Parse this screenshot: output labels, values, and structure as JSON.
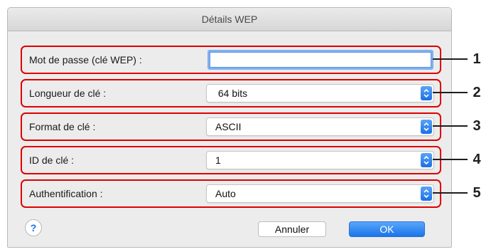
{
  "dialog": {
    "title": "Détails WEP"
  },
  "fields": {
    "password_label": "Mot de passe (clé WEP) :",
    "password_value": "",
    "key_length_label": "Longueur de clé :",
    "key_length_value": " 64 bits",
    "key_format_label": "Format de clé :",
    "key_format_value": "ASCII",
    "key_id_label": "ID de clé :",
    "key_id_value": "1",
    "auth_label": "Authentification :",
    "auth_value": "Auto"
  },
  "callouts": [
    "1",
    "2",
    "3",
    "4",
    "5"
  ],
  "buttons": {
    "help": "?",
    "cancel": "Annuler",
    "ok": "OK"
  },
  "icons": {
    "select_arrow": "updown-chevron-icon",
    "help": "help-icon"
  },
  "colors": {
    "callout_border": "#e00000",
    "accent_blue": "#1b6fe8",
    "window_bg": "#ececec"
  }
}
